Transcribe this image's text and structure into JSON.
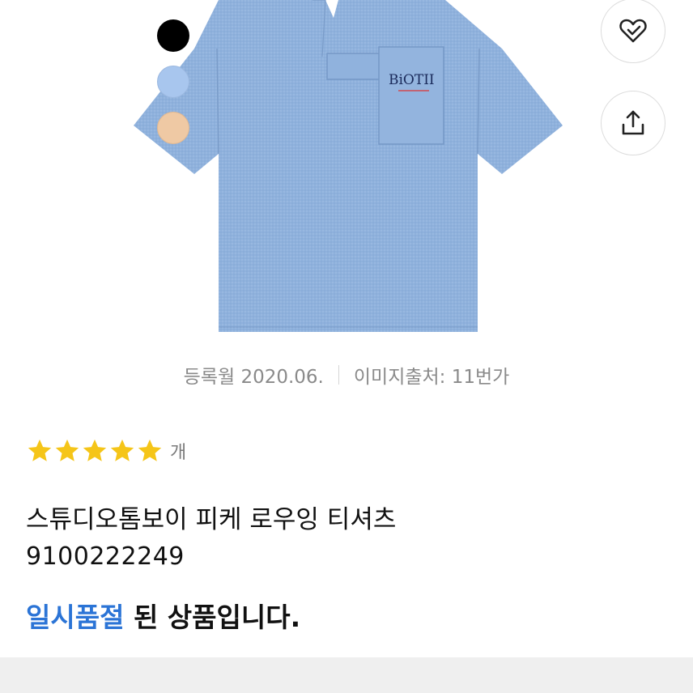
{
  "product": {
    "name": "스튜디오톰보이 피케 로우잉 티셔츠",
    "code": "9100222249",
    "pocket_logo": "BiOTII",
    "image_alt": "스튜디오톰보이 피케 로우잉 티셔츠"
  },
  "swatches": [
    {
      "name": "black",
      "color": "#000000"
    },
    {
      "name": "light-blue",
      "color": "#a8c6ee"
    },
    {
      "name": "beige",
      "color": "#efc9a4"
    }
  ],
  "meta": {
    "registered": "등록월 2020.06.",
    "image_source": "이미지출처: 11번가"
  },
  "rating": {
    "stars": 5,
    "count_unit": "개",
    "star_color": "#f5c518"
  },
  "status": {
    "highlight": "일시품절",
    "rest": " 된 상품입니다.",
    "highlight_color": "#2b74d6"
  },
  "actions": {
    "wish_icon": "heart-check-icon",
    "share_icon": "share-icon"
  }
}
